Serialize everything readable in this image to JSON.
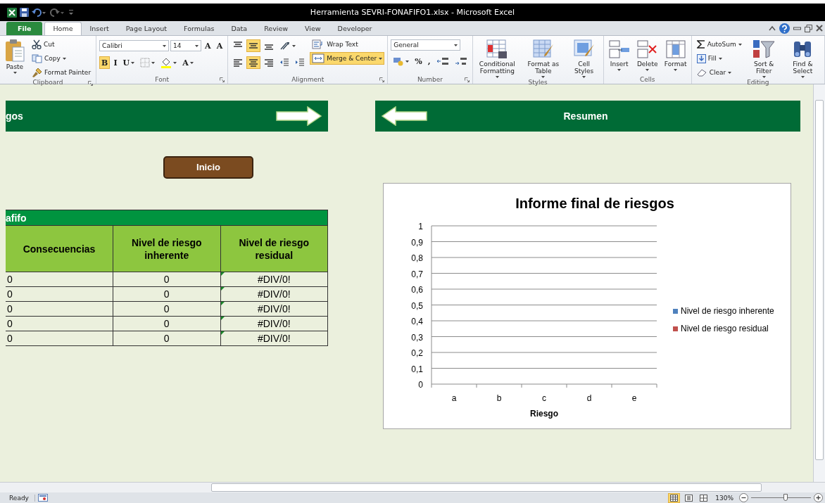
{
  "window": {
    "title": "Herramienta SEVRI-FONAFIFO1.xlsx  -  Microsoft Excel"
  },
  "tabs": [
    {
      "label": "File",
      "selected": false,
      "kind": "file"
    },
    {
      "label": "Home",
      "selected": true,
      "kind": "tab"
    },
    {
      "label": "Insert",
      "selected": false,
      "kind": "tab"
    },
    {
      "label": "Page Layout",
      "selected": false,
      "kind": "tab"
    },
    {
      "label": "Formulas",
      "selected": false,
      "kind": "tab"
    },
    {
      "label": "Data",
      "selected": false,
      "kind": "tab"
    },
    {
      "label": "Review",
      "selected": false,
      "kind": "tab"
    },
    {
      "label": "View",
      "selected": false,
      "kind": "tab"
    },
    {
      "label": "Developer",
      "selected": false,
      "kind": "tab"
    }
  ],
  "ribbon": {
    "groups": [
      {
        "label": "Clipboard",
        "launcher": true,
        "items": [
          {
            "kind": "large",
            "label": "Paste",
            "dropdown": true
          },
          {
            "kind": "stack",
            "children": [
              {
                "kind": "small",
                "label": "Cut"
              },
              {
                "kind": "small",
                "label": "Copy",
                "dropdown": true
              },
              {
                "kind": "small",
                "label": "Format Painter"
              }
            ]
          }
        ]
      },
      {
        "label": "Font",
        "launcher": true,
        "items": [
          {
            "kind": "lines",
            "lines": [
              {
                "controls": [
                  {
                    "kind": "combo",
                    "value": "Calibri"
                  },
                  {
                    "kind": "combo",
                    "value": "14"
                  },
                  {
                    "kind": "tool",
                    "label": "A"
                  },
                  {
                    "kind": "tool",
                    "label": "A"
                  }
                ]
              },
              {
                "controls": [
                  {
                    "kind": "tool",
                    "label": "B",
                    "selected": true
                  },
                  {
                    "kind": "tool",
                    "label": "I",
                    "selected": false
                  },
                  {
                    "kind": "tool",
                    "label": "U",
                    "selected": false,
                    "dropdown": true
                  },
                  {
                    "kind": "tool",
                    "dropdown": true
                  },
                  {
                    "kind": "tool",
                    "dropdown": true
                  },
                  {
                    "kind": "tool",
                    "label": "A",
                    "dropdown": true
                  }
                ]
              }
            ]
          }
        ]
      },
      {
        "label": "Alignment",
        "launcher": true,
        "items": [
          {
            "kind": "lines",
            "lines": [
              {
                "controls": [
                  {
                    "kind": "tool",
                    "selected": false
                  },
                  {
                    "kind": "tool",
                    "selected": true
                  },
                  {
                    "kind": "tool",
                    "selected": false
                  },
                  {
                    "kind": "tool",
                    "dropdown": true
                  }
                ]
              },
              {
                "controls": [
                  {
                    "kind": "tool",
                    "selected": false
                  },
                  {
                    "kind": "tool",
                    "selected": true
                  },
                  {
                    "kind": "tool",
                    "selected": false
                  },
                  {
                    "kind": "tool"
                  },
                  {
                    "kind": "tool"
                  }
                ]
              }
            ]
          },
          {
            "kind": "stack",
            "children": [
              {
                "kind": "small",
                "label": "Wrap Text",
                "selected": false
              },
              {
                "kind": "small",
                "label": "Merge & Center",
                "selected": true,
                "dropdown": true
              }
            ]
          }
        ]
      },
      {
        "label": "Number",
        "launcher": true,
        "items": [
          {
            "kind": "lines",
            "lines": [
              {
                "controls": [
                  {
                    "kind": "combo",
                    "value": "General"
                  }
                ]
              },
              {
                "controls": [
                  {
                    "kind": "tool",
                    "dropdown": true
                  },
                  {
                    "kind": "tool",
                    "label": "%"
                  },
                  {
                    "kind": "tool",
                    "label": ","
                  },
                  {
                    "kind": "tool"
                  },
                  {
                    "kind": "tool"
                  }
                ]
              }
            ]
          }
        ]
      },
      {
        "label": "Styles",
        "items": [
          {
            "kind": "large",
            "label": "Conditional Formatting",
            "dropdown": true
          },
          {
            "kind": "large",
            "label": "Format as Table",
            "dropdown": true
          },
          {
            "kind": "large",
            "label": "Cell Styles",
            "dropdown": true
          }
        ]
      },
      {
        "label": "Cells",
        "items": [
          {
            "kind": "large",
            "label": "Insert",
            "dropdown": true
          },
          {
            "kind": "large",
            "label": "Delete",
            "dropdown": true
          },
          {
            "kind": "large",
            "label": "Format",
            "dropdown": true
          }
        ]
      },
      {
        "label": "Editing",
        "items": [
          {
            "kind": "stack",
            "children": [
              {
                "kind": "small",
                "label": "AutoSum",
                "dropdown": true
              },
              {
                "kind": "small",
                "label": "Fill",
                "dropdown": true
              },
              {
                "kind": "small",
                "label": "Clear",
                "dropdown": true
              }
            ]
          },
          {
            "kind": "large",
            "label": "Sort & Filter",
            "dropdown": true
          },
          {
            "kind": "large",
            "label": "Find & Select",
            "dropdown": true
          }
        ]
      }
    ]
  },
  "sheet": {
    "left_banner": {
      "text": "gos"
    },
    "right_banner": {
      "text": "Resumen"
    },
    "home_button": {
      "label": "Inicio"
    },
    "table": {
      "title": "afifo",
      "columns": [
        "Consecuencias",
        "Nivel de riesgo inherente",
        "Nivel de riesgo residual"
      ],
      "rows": [
        {
          "cells": [
            "0",
            "0",
            "#DIV/0!"
          ],
          "flagged": true
        },
        {
          "cells": [
            "0",
            "0",
            "#DIV/0!"
          ],
          "flagged": true
        },
        {
          "cells": [
            "0",
            "0",
            "#DIV/0!"
          ],
          "flagged": true
        },
        {
          "cells": [
            "0",
            "0",
            "#DIV/0!"
          ],
          "flagged": true
        },
        {
          "cells": [
            "0",
            "0",
            "#DIV/0!"
          ],
          "flagged": true
        }
      ]
    },
    "chart": {
      "chart_data": {
        "type": "bar",
        "title": "Informe final de riesgos",
        "xlabel": "Riesgo",
        "categories": [
          "a",
          "b",
          "c",
          "d",
          "e"
        ],
        "series": [
          {
            "name": "Nivel de riesgo inherente",
            "color": "#4f81bd",
            "values": [
              0,
              0,
              0,
              0,
              0
            ]
          },
          {
            "name": "Nivel de riesgo residual",
            "color": "#c0504d",
            "values": [
              null,
              null,
              null,
              null,
              null
            ]
          }
        ],
        "ylim": [
          0,
          1
        ],
        "grid": true,
        "yticks": [
          {
            "value": 0,
            "label": "0"
          },
          {
            "value": 0.1,
            "label": "0,1"
          },
          {
            "value": 0.2,
            "label": "0,2"
          },
          {
            "value": 0.3,
            "label": "0,3"
          },
          {
            "value": 0.4,
            "label": "0,4"
          },
          {
            "value": 0.5,
            "label": "0,5"
          },
          {
            "value": 0.6,
            "label": "0,6"
          },
          {
            "value": 0.7,
            "label": "0,7"
          },
          {
            "value": 0.8,
            "label": "0,8"
          },
          {
            "value": 0.9,
            "label": "0,9"
          },
          {
            "value": 1,
            "label": "1"
          }
        ]
      }
    }
  },
  "status_bar": {
    "status": "Ready",
    "views": [
      {
        "selected": true
      },
      {
        "selected": false
      },
      {
        "selected": false
      }
    ],
    "zoom": {
      "label": "130%",
      "level": 0.58
    }
  }
}
